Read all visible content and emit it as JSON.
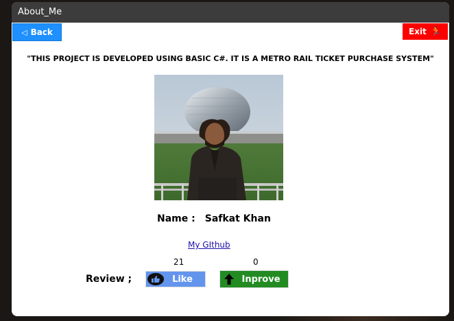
{
  "window": {
    "title": "About_Me"
  },
  "toolbar": {
    "back_label": "Back",
    "exit_label": "Exit"
  },
  "description": "\"THIS PROJECT IS DEVELOPED USING BASIC C#. IT IS A METRO RAIL TICKET PURCHASE SYSTEM\"",
  "profile": {
    "name_label": "Name :",
    "name_value": "Safkat Khan",
    "github_label": "My GIthub "
  },
  "review": {
    "label": "Review ;",
    "like_label": "Like",
    "like_count": "21",
    "improve_label": "Inprove",
    "improve_count": "0"
  },
  "colors": {
    "back": "#1e90ff",
    "exit": "#ff0000",
    "like": "#6495ed",
    "improve": "#228b22",
    "titlebar": "#3c3c3c"
  }
}
